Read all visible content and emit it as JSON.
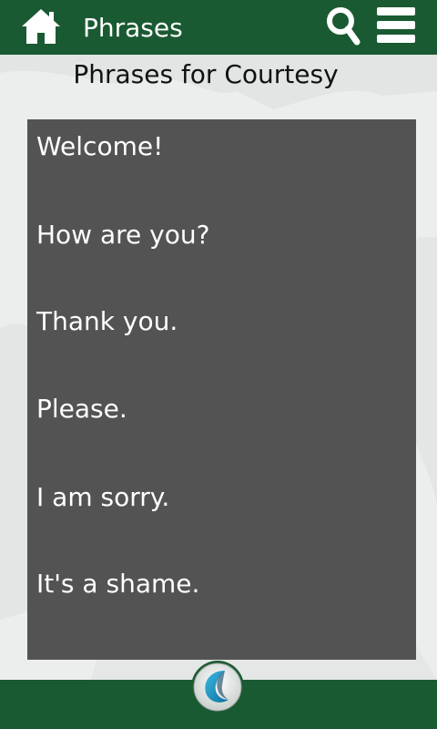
{
  "header": {
    "title": "Phrases",
    "home_icon": "home-icon",
    "search_icon": "search-icon",
    "menu_icon": "menu-icon",
    "bar_color": "#1a5a32"
  },
  "page": {
    "heading": "Phrases for Courtesy"
  },
  "phrases": {
    "items": [
      {
        "text": "Welcome!"
      },
      {
        "text": "How are you?"
      },
      {
        "text": "Thank you."
      },
      {
        "text": "Please."
      },
      {
        "text": "I am sorry."
      },
      {
        "text": "It's a shame."
      }
    ],
    "panel_color": "#535353"
  },
  "footer": {
    "logo_icon": "app-logo-icon"
  }
}
